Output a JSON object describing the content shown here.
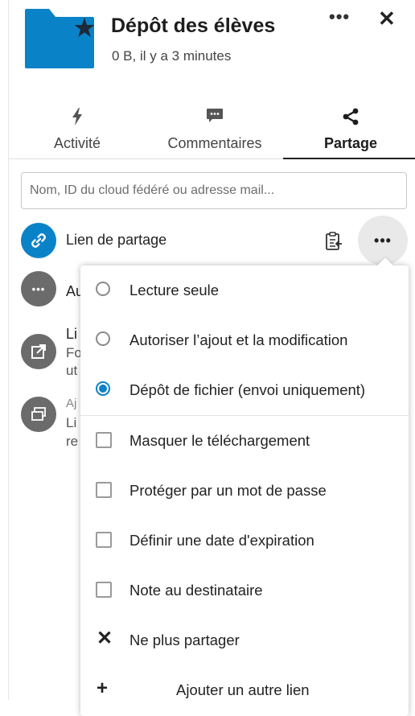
{
  "header": {
    "title": "Dépôt des élèves",
    "subtitle": "0 B, il y a 3 minutes",
    "more_label": "•••",
    "close_label": "✕",
    "folder_color": "#0a82c8"
  },
  "tabs": [
    {
      "label": "Activité",
      "icon": "bolt-icon"
    },
    {
      "label": "Commentaires",
      "icon": "comment-icon"
    },
    {
      "label": "Partage",
      "icon": "share-icon",
      "active": true
    }
  ],
  "share": {
    "placeholder": "Nom, ID du cloud fédéré ou adresse mail..."
  },
  "rows": {
    "link_label": "Lien de partage",
    "row2_label": "Au",
    "row3_title": "Li",
    "row3_line2": "Fo",
    "row3_line3": "ut",
    "row4_line1": "Aj",
    "row4_line2": "Li",
    "row4_line3": "re",
    "more_label": "•••"
  },
  "menu": {
    "items": [
      {
        "label": "Lecture seule",
        "type": "radio",
        "checked": false
      },
      {
        "label": "Autoriser l’ajout et la modification",
        "type": "radio",
        "checked": false
      },
      {
        "label": "Dépôt de fichier (envoi uniquement)",
        "type": "radio",
        "checked": true
      },
      {
        "label": "Masquer le téléchargement",
        "type": "checkbox",
        "checked": false
      },
      {
        "label": "Protéger par un mot de passe",
        "type": "checkbox",
        "checked": false
      },
      {
        "label": "Définir une date d'expiration",
        "type": "checkbox",
        "checked": false
      },
      {
        "label": "Note au destinataire",
        "type": "checkbox",
        "checked": false
      },
      {
        "label": "Ne plus partager",
        "type": "action",
        "icon": "close-icon"
      },
      {
        "label": "Ajouter un autre lien",
        "type": "action",
        "icon": "plus-icon"
      }
    ],
    "unshare_symbol": "✕",
    "add_symbol": "+"
  },
  "colors": {
    "accent": "#0a82c8",
    "gray_circle": "#6b6b6b"
  }
}
